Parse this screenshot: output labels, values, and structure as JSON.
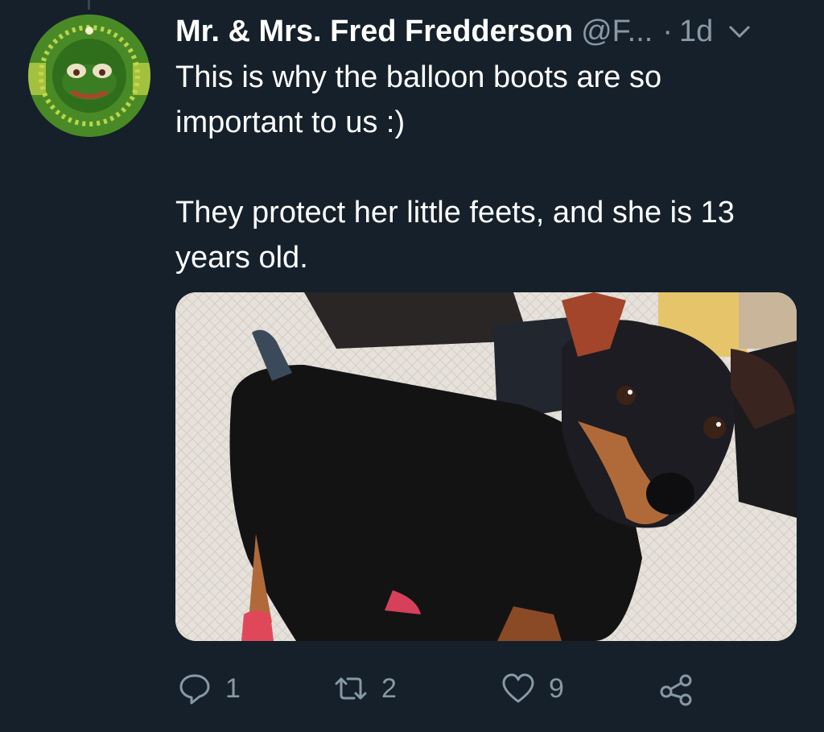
{
  "tweet": {
    "display_name": "Mr. & Mrs. Fred Fredderson",
    "handle": "@F...",
    "separator": "·",
    "time": "1d",
    "text_line_1": "This is why the balloon boots are so important to us :)",
    "text_line_2": "They protect her little feets, and she is 13 years old.",
    "media_subject": "dog wearing pink balloon boots"
  },
  "actions": {
    "reply_count": "1",
    "retweet_count": "2",
    "like_count": "9"
  },
  "icons": {
    "reply": "reply-icon",
    "retweet": "retweet-icon",
    "like": "heart-icon",
    "share": "share-icon",
    "more": "chevron-down-icon"
  },
  "colors": {
    "background": "#15202b",
    "secondary_text": "#8899a6",
    "primary_text": "#ffffff"
  }
}
